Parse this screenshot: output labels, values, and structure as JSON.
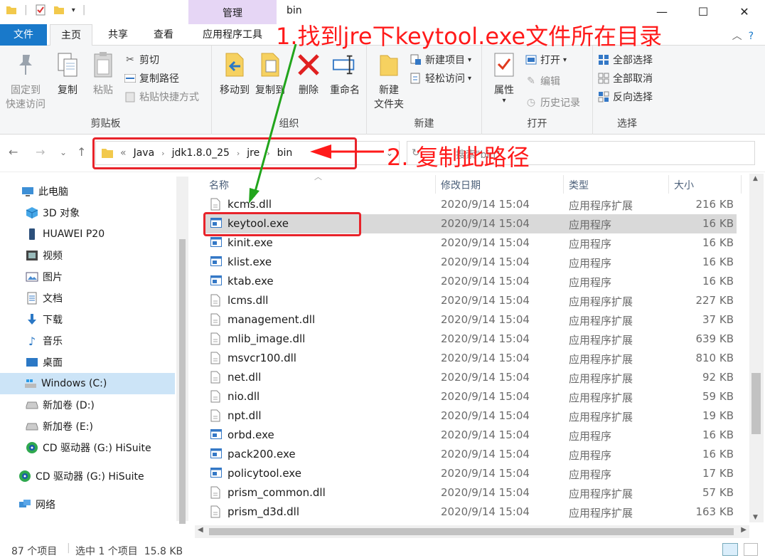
{
  "window": {
    "title": "bin",
    "context_tab_group": "管理",
    "controls": {
      "minimize": "—",
      "maximize": "☐",
      "close": "✕"
    }
  },
  "ribbon_tabs": [
    "文件",
    "主页",
    "共享",
    "查看",
    "应用程序工具"
  ],
  "ribbon": {
    "clipboard": {
      "label": "剪贴板",
      "pin_line1": "固定到",
      "pin_line2": "快速访问",
      "copy": "复制",
      "paste": "粘贴",
      "cut": "剪切",
      "copy_path": "复制路径",
      "paste_shortcut": "粘贴快捷方式"
    },
    "organize": {
      "label": "组织",
      "move_to": "移动到",
      "copy_to": "复制到",
      "delete": "删除",
      "rename": "重命名"
    },
    "new": {
      "label": "新建",
      "new_folder_line1": "新建",
      "new_folder_line2": "文件夹",
      "new_item": "新建项目",
      "easy_access": "轻松访问"
    },
    "open": {
      "label": "打开",
      "properties": "属性",
      "open": "打开",
      "edit": "编辑",
      "history": "历史记录"
    },
    "select": {
      "label": "选择",
      "select_all": "全部选择",
      "select_none": "全部取消",
      "invert": "反向选择"
    }
  },
  "address": {
    "crumbs": [
      "«",
      "Java",
      "jdk1.8.0_25",
      "jre",
      "bin"
    ],
    "search_placeholder": "搜索\"bin\""
  },
  "sidebar": {
    "items": [
      {
        "label": "此电脑",
        "icon": "pc-icon"
      },
      {
        "label": "3D 对象",
        "icon": "3d-objects-icon"
      },
      {
        "label": "HUAWEI P20",
        "icon": "phone-icon"
      },
      {
        "label": "视频",
        "icon": "video-icon"
      },
      {
        "label": "图片",
        "icon": "pictures-icon"
      },
      {
        "label": "文档",
        "icon": "documents-icon"
      },
      {
        "label": "下载",
        "icon": "download-icon"
      },
      {
        "label": "音乐",
        "icon": "music-icon"
      },
      {
        "label": "桌面",
        "icon": "desktop-icon"
      },
      {
        "label": "Windows (C:)",
        "icon": "windows-drive-icon"
      },
      {
        "label": "新加卷 (D:)",
        "icon": "drive-icon"
      },
      {
        "label": "新加卷 (E:)",
        "icon": "drive-icon"
      },
      {
        "label": "CD 驱动器 (G:) HiSuite",
        "icon": "cd-drive-icon"
      },
      {
        "label": "CD 驱动器 (G:) HiSuite",
        "icon": "cd-drive-icon"
      },
      {
        "label": "网络",
        "icon": "network-icon"
      }
    ]
  },
  "columns": {
    "name": "名称",
    "date": "修改日期",
    "type": "类型",
    "size": "大小"
  },
  "files": [
    {
      "name": "kcms.dll",
      "date": "2020/9/14 15:04",
      "type": "应用程序扩展",
      "size": "216 KB",
      "kind": "dll"
    },
    {
      "name": "keytool.exe",
      "date": "2020/9/14 15:04",
      "type": "应用程序",
      "size": "16 KB",
      "kind": "exe"
    },
    {
      "name": "kinit.exe",
      "date": "2020/9/14 15:04",
      "type": "应用程序",
      "size": "16 KB",
      "kind": "exe"
    },
    {
      "name": "klist.exe",
      "date": "2020/9/14 15:04",
      "type": "应用程序",
      "size": "16 KB",
      "kind": "exe"
    },
    {
      "name": "ktab.exe",
      "date": "2020/9/14 15:04",
      "type": "应用程序",
      "size": "16 KB",
      "kind": "exe"
    },
    {
      "name": "lcms.dll",
      "date": "2020/9/14 15:04",
      "type": "应用程序扩展",
      "size": "227 KB",
      "kind": "dll"
    },
    {
      "name": "management.dll",
      "date": "2020/9/14 15:04",
      "type": "应用程序扩展",
      "size": "37 KB",
      "kind": "dll"
    },
    {
      "name": "mlib_image.dll",
      "date": "2020/9/14 15:04",
      "type": "应用程序扩展",
      "size": "639 KB",
      "kind": "dll"
    },
    {
      "name": "msvcr100.dll",
      "date": "2020/9/14 15:04",
      "type": "应用程序扩展",
      "size": "810 KB",
      "kind": "dll"
    },
    {
      "name": "net.dll",
      "date": "2020/9/14 15:04",
      "type": "应用程序扩展",
      "size": "92 KB",
      "kind": "dll"
    },
    {
      "name": "nio.dll",
      "date": "2020/9/14 15:04",
      "type": "应用程序扩展",
      "size": "59 KB",
      "kind": "dll"
    },
    {
      "name": "npt.dll",
      "date": "2020/9/14 15:04",
      "type": "应用程序扩展",
      "size": "19 KB",
      "kind": "dll"
    },
    {
      "name": "orbd.exe",
      "date": "2020/9/14 15:04",
      "type": "应用程序",
      "size": "16 KB",
      "kind": "exe"
    },
    {
      "name": "pack200.exe",
      "date": "2020/9/14 15:04",
      "type": "应用程序",
      "size": "16 KB",
      "kind": "exe"
    },
    {
      "name": "policytool.exe",
      "date": "2020/9/14 15:04",
      "type": "应用程序",
      "size": "17 KB",
      "kind": "exe"
    },
    {
      "name": "prism_common.dll",
      "date": "2020/9/14 15:04",
      "type": "应用程序扩展",
      "size": "57 KB",
      "kind": "dll"
    },
    {
      "name": "prism_d3d.dll",
      "date": "2020/9/14 15:04",
      "type": "应用程序扩展",
      "size": "163 KB",
      "kind": "dll"
    }
  ],
  "status": {
    "count": "87 个项目",
    "selection": "选中 1 个项目  15.8 KB"
  },
  "annotations": {
    "step1": "1.找到jre下keytool.exe文件所在目录",
    "step2": "2. 复制此路径",
    "color": "#ff1a1a",
    "arrow_color": "#22a51c"
  }
}
